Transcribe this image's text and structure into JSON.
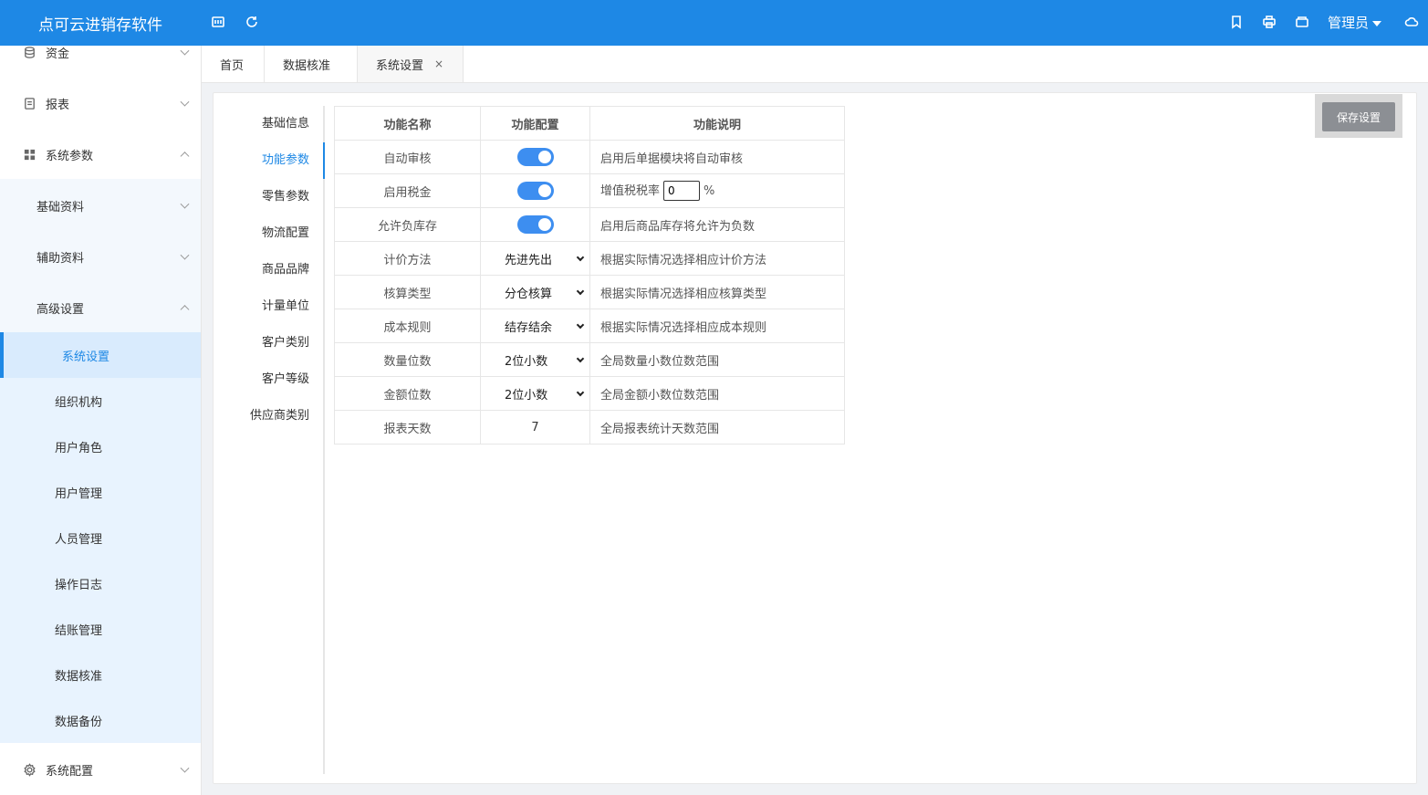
{
  "header": {
    "brand": "点可云进销存软件",
    "admin": "管理员",
    "icons": [
      "calendar-icon",
      "refresh-icon",
      "bookmark-icon",
      "print-icon",
      "box-icon",
      "cloud-icon"
    ]
  },
  "sidebar": {
    "top_items": [
      {
        "label": "资金",
        "icon": "database-icon"
      },
      {
        "label": "报表",
        "icon": "document-icon"
      },
      {
        "label": "系统参数",
        "icon": "grid-icon"
      }
    ],
    "sub_groups": [
      {
        "label": "基础资料"
      },
      {
        "label": "辅助资料"
      },
      {
        "label": "高级设置"
      }
    ],
    "leaves": [
      "系统设置",
      "组织机构",
      "用户角色",
      "用户管理",
      "人员管理",
      "操作日志",
      "结账管理",
      "数据核准",
      "数据备份"
    ],
    "bottom_item": {
      "label": "系统配置",
      "icon": "gear-icon"
    }
  },
  "tabs": [
    {
      "label": "首页"
    },
    {
      "label": "数据核准"
    },
    {
      "label": "系统设置",
      "close": "×"
    }
  ],
  "vnav": [
    "基础信息",
    "功能参数",
    "零售参数",
    "物流配置",
    "商品品牌",
    "计量单位",
    "客户类别",
    "客户等级",
    "供应商类别"
  ],
  "save_label": "保存设置",
  "table": {
    "headers": [
      "功能名称",
      "功能配置",
      "功能说明"
    ],
    "rows": [
      {
        "name": "自动审核",
        "type": "switch",
        "on": true,
        "desc": "启用后单据模块将自动审核"
      },
      {
        "name": "启用税金",
        "type": "switch",
        "on": true,
        "desc_prefix": "增值税税率",
        "tax_value": "0",
        "desc_suffix": "%"
      },
      {
        "name": "允许负库存",
        "type": "switch",
        "on": true,
        "desc": "启用后商品库存将允许为负数"
      },
      {
        "name": "计价方法",
        "type": "select",
        "value": "先进先出",
        "desc": "根据实际情况选择相应计价方法"
      },
      {
        "name": "核算类型",
        "type": "select",
        "value": "分仓核算",
        "desc": "根据实际情况选择相应核算类型"
      },
      {
        "name": "成本规则",
        "type": "select",
        "value": "结存结余",
        "desc": "根据实际情况选择相应成本规则"
      },
      {
        "name": "数量位数",
        "type": "select",
        "value": "2位小数",
        "desc": "全局数量小数位数范围"
      },
      {
        "name": "金额位数",
        "type": "select",
        "value": "2位小数",
        "desc": "全局金额小数位数范围"
      },
      {
        "name": "报表天数",
        "type": "text",
        "value": "7",
        "desc": "全局报表统计天数范围"
      }
    ]
  }
}
